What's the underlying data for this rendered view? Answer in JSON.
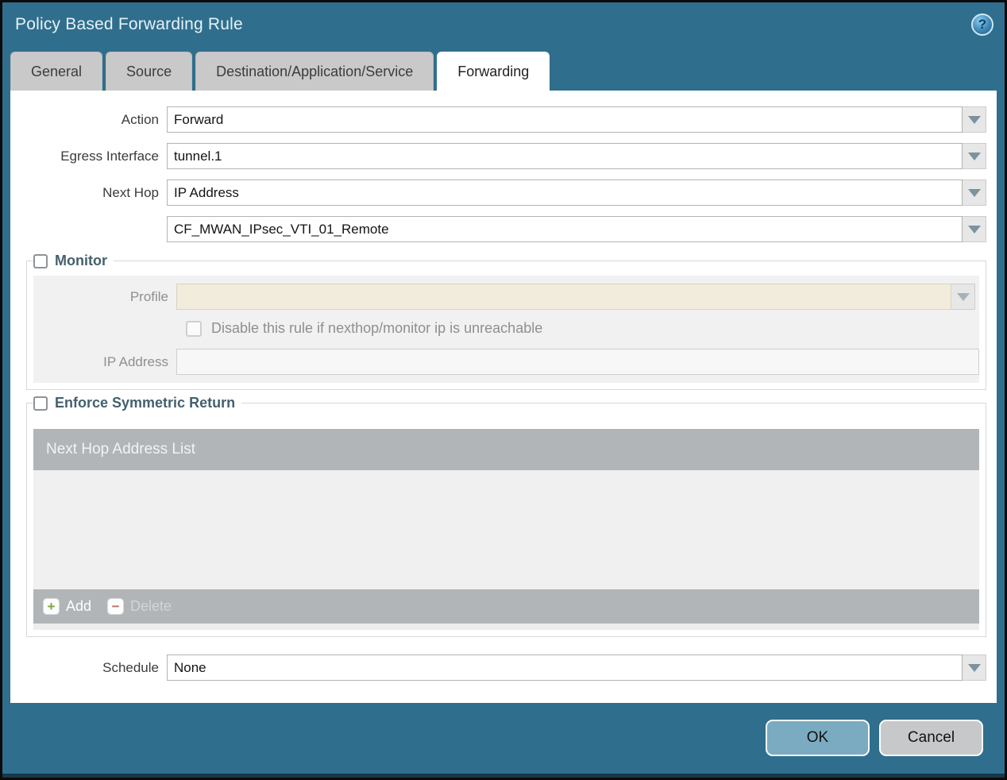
{
  "dialog": {
    "title": "Policy Based Forwarding Rule"
  },
  "icons": {
    "help": "?",
    "add": "+",
    "delete": "−"
  },
  "tabs": [
    {
      "label": "General",
      "active": false
    },
    {
      "label": "Source",
      "active": false
    },
    {
      "label": "Destination/Application/Service",
      "active": false
    },
    {
      "label": "Forwarding",
      "active": true
    }
  ],
  "form": {
    "action": {
      "label": "Action",
      "value": "Forward"
    },
    "egress_interface": {
      "label": "Egress Interface",
      "value": "tunnel.1"
    },
    "next_hop": {
      "label": "Next Hop",
      "value": "IP Address"
    },
    "next_hop_address": {
      "value": "CF_MWAN_IPsec_VTI_01_Remote"
    },
    "schedule": {
      "label": "Schedule",
      "value": "None"
    }
  },
  "monitor": {
    "legend": "Monitor",
    "checked": false,
    "profile": {
      "label": "Profile",
      "value": ""
    },
    "disable_rule_label": "Disable this rule if nexthop/monitor ip is unreachable",
    "disable_rule_checked": false,
    "ip_address": {
      "label": "IP Address",
      "value": ""
    }
  },
  "symmetric_return": {
    "legend": "Enforce Symmetric Return",
    "checked": false,
    "table": {
      "header": "Next Hop Address List",
      "rows": []
    },
    "add_label": "Add",
    "delete_label": "Delete"
  },
  "footer": {
    "ok_label": "OK",
    "cancel_label": "Cancel"
  },
  "colors": {
    "teal": "#306e8d",
    "disabled_field_beige": "#f1ecdb",
    "legend_text": "#44606e"
  }
}
